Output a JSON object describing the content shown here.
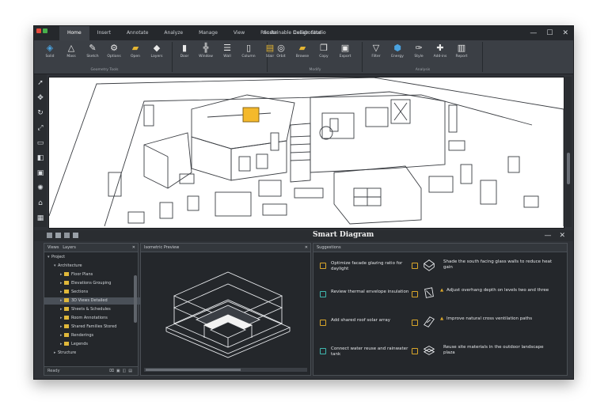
{
  "titlebar": {
    "title": "Sustainable Design Studio",
    "menu": [
      "Home",
      "Insert",
      "Annotate",
      "Analyze",
      "Manage",
      "View",
      "Render",
      "Collaborate"
    ],
    "controls": [
      "—",
      "☐",
      "✕"
    ]
  },
  "ribbon": {
    "groups": [
      {
        "caption": "Geometry Tools",
        "buttons": [
          {
            "icon": "cube-icon",
            "glyph": "◈",
            "label": "Solid"
          },
          {
            "icon": "pyramid-icon",
            "glyph": "△",
            "label": "Mass"
          },
          {
            "icon": "pen-icon",
            "glyph": "✎",
            "label": "Sketch"
          },
          {
            "icon": "gear-icon",
            "glyph": "⚙",
            "label": "Options"
          },
          {
            "icon": "folder-icon",
            "glyph": "▰",
            "label": "Open"
          },
          {
            "icon": "layers-icon",
            "glyph": "◆",
            "label": "Layers"
          }
        ]
      },
      {
        "caption": "",
        "buttons": [
          {
            "icon": "door-icon",
            "glyph": "▮",
            "label": "Door"
          },
          {
            "icon": "window-icon",
            "glyph": "╬",
            "label": "Window"
          },
          {
            "icon": "wall-icon",
            "glyph": "☰",
            "label": "Wall"
          },
          {
            "icon": "column-icon",
            "glyph": "▯",
            "label": "Column"
          },
          {
            "icon": "stair-icon",
            "glyph": "▤",
            "label": "Stair"
          }
        ]
      },
      {
        "caption": "Modify",
        "buttons": [
          {
            "icon": "orbit-icon",
            "glyph": "◎",
            "label": "Orbit"
          },
          {
            "icon": "folder-open-icon",
            "glyph": "▰",
            "label": "Browse"
          },
          {
            "icon": "copy-icon",
            "glyph": "❐",
            "label": "Copy"
          },
          {
            "icon": "export-icon",
            "glyph": "▣",
            "label": "Export"
          }
        ]
      },
      {
        "caption": "Analysis",
        "buttons": [
          {
            "icon": "filter-icon",
            "glyph": "▽",
            "label": "Filter"
          },
          {
            "icon": "energy-icon",
            "glyph": "⬢",
            "label": "Energy"
          },
          {
            "icon": "brush-icon",
            "glyph": "✑",
            "label": "Style"
          },
          {
            "icon": "puzzle-icon",
            "glyph": "✚",
            "label": "Add-ins"
          },
          {
            "icon": "clipboard-icon",
            "glyph": "▥",
            "label": "Report"
          }
        ]
      }
    ]
  },
  "left_toolbar": [
    "select-icon",
    "move-icon",
    "rotate-icon",
    "scale-icon",
    "measure-icon",
    "section-icon",
    "camera-icon",
    "light-icon",
    "tag-icon",
    "grid-icon"
  ],
  "bottom": {
    "panel_title": "Smart Diagram",
    "controls": [
      "—",
      "✕"
    ]
  },
  "tree": {
    "header": [
      "Views",
      "Layers"
    ],
    "items": [
      {
        "label": "Project",
        "level": 0,
        "folder": false,
        "arrow": "▾"
      },
      {
        "label": "Architecture",
        "level": 1,
        "folder": false,
        "arrow": "▾"
      },
      {
        "label": "Floor Plans",
        "level": 2,
        "folder": true,
        "arrow": "▸"
      },
      {
        "label": "Elevations Grouping",
        "level": 2,
        "folder": true,
        "arrow": "▸"
      },
      {
        "label": "Sections",
        "level": 2,
        "folder": true,
        "arrow": "▸"
      },
      {
        "label": "3D Views Detailed",
        "level": 2,
        "folder": true,
        "arrow": "▸",
        "selected": true
      },
      {
        "label": "Sheets & Schedules",
        "level": 2,
        "folder": true,
        "arrow": "▸"
      },
      {
        "label": "Room Annotations",
        "level": 2,
        "folder": true,
        "arrow": "▸"
      },
      {
        "label": "Shared Families Stored",
        "level": 2,
        "folder": true,
        "arrow": "▸"
      },
      {
        "label": "Renderings",
        "level": 2,
        "folder": true,
        "arrow": "▸"
      },
      {
        "label": "Legends",
        "level": 2,
        "folder": true,
        "arrow": "▸"
      },
      {
        "label": "Structure",
        "level": 1,
        "folder": false,
        "arrow": "▸"
      }
    ],
    "footer": "Ready"
  },
  "preview": {
    "tab": "Isometric Preview"
  },
  "suggestions": {
    "header": "Suggestions",
    "left": [
      {
        "text": "Optimize facade glazing ratio for daylight",
        "color": "#d9a62a"
      },
      {
        "text": "Review thermal envelope insulation",
        "color": "#3fb8b0"
      },
      {
        "text": "Add shared roof solar array",
        "color": "#d9a62a"
      },
      {
        "text": "Connect water reuse and rainwater tank",
        "color": "#3fb8b0"
      }
    ],
    "right": [
      {
        "text": "Shade the south facing glass walls to reduce heat gain",
        "warn": false
      },
      {
        "text": "Adjust overhang depth on levels two and three",
        "warn": true
      },
      {
        "text": "Improve natural cross ventilation paths",
        "warn": true
      },
      {
        "text": "Reuse site materials in the outdoor landscape plaza",
        "warn": false
      }
    ]
  },
  "colors": {
    "accent": "#d9a62a",
    "teal": "#3fb8b0",
    "chrome": "#2f3237"
  }
}
